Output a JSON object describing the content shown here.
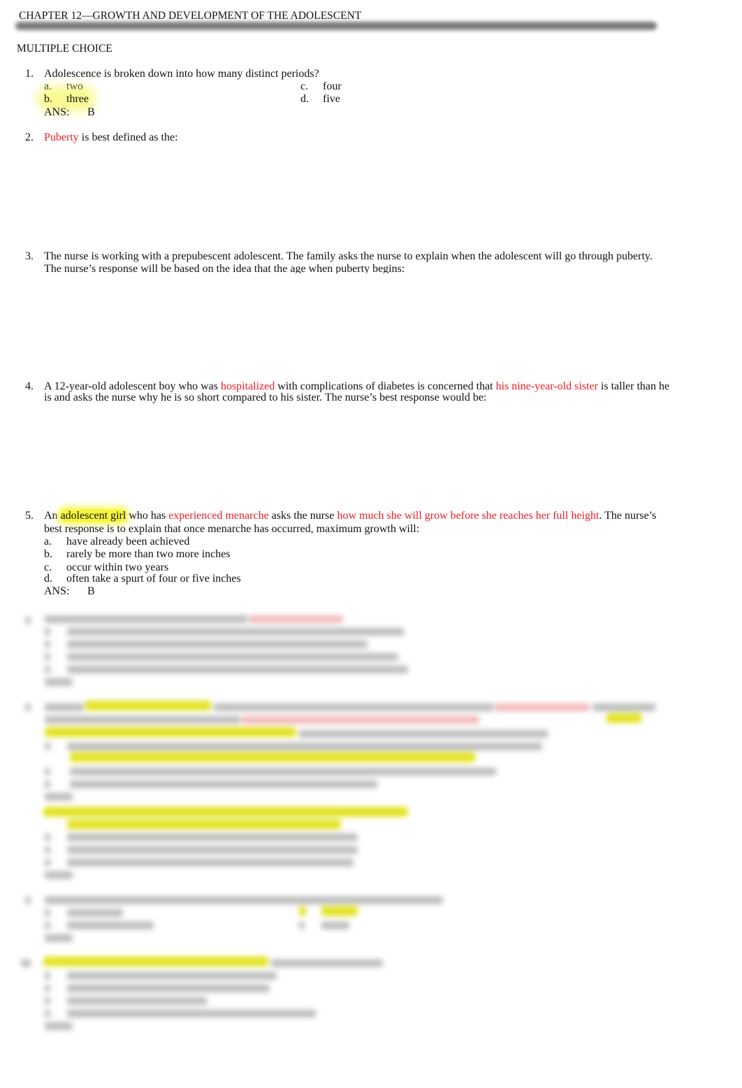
{
  "document": {
    "chapter_title": "CHAPTER 12—GROWTH AND DEVELOPMENT OF THE ADOLESCENT",
    "section_title": "MULTIPLE CHOICE",
    "answer_label": "ANS:",
    "highlight_color": "#f6f63a",
    "emphasis_color": "#ee1c24"
  },
  "questions": [
    {
      "number": "1.",
      "text": "Adolescence is broken down into how many distinct periods?",
      "options": [
        {
          "letter": "a.",
          "text": "two"
        },
        {
          "letter": "b.",
          "text": "three",
          "highlighted": true
        },
        {
          "letter": "c.",
          "text": "four"
        },
        {
          "letter": "d.",
          "text": "five"
        }
      ],
      "answer": "B"
    },
    {
      "number": "2.",
      "segments": [
        {
          "text": "Puberty",
          "style": "red"
        },
        {
          "text": " is best defined as the:"
        }
      ]
    },
    {
      "number": "3.",
      "lines": [
        "The nurse is working with a prepubescent adolescent. The family asks the nurse to explain when the adolescent will go through puberty.",
        "The nurse’s response will be based on the idea that the age when puberty begins:"
      ]
    },
    {
      "number": "4.",
      "line1": [
        {
          "text": "A 12-year-old adolescent boy who was "
        },
        {
          "text": "hospitalized",
          "style": "red"
        },
        {
          "text": " with complications of diabetes is concerned that "
        },
        {
          "text": "his nine-year-old sister",
          "style": "red"
        },
        {
          "text": " is taller than he"
        }
      ],
      "line2": "is and asks the nurse why he is so short compared to his sister. The nurse’s best response would be:"
    },
    {
      "number": "5.",
      "line1": [
        {
          "text": "An "
        },
        {
          "text": "adolescent girl",
          "style": "highlight"
        },
        {
          "text": " who has "
        },
        {
          "text": "experienced menarche",
          "style": "red"
        },
        {
          "text": " asks the nurse "
        },
        {
          "text": "how much she will grow before she reaches her full height",
          "style": "red"
        },
        {
          "text": ". The nurse’s"
        }
      ],
      "line2": "best response is to explain that once menarche has occurred, maximum growth will:",
      "options": [
        {
          "letter": "a.",
          "text": "have already been achieved"
        },
        {
          "letter": "b.",
          "text": "rarely be more than two more inches"
        },
        {
          "letter": "c.",
          "text": "occur within two years"
        },
        {
          "letter": "d.",
          "text": "often take a spurt of four or five inches"
        }
      ],
      "answer": "B"
    }
  ],
  "blurred_content": {
    "description": "Questions 6–10 are blurred (preview locked)"
  }
}
